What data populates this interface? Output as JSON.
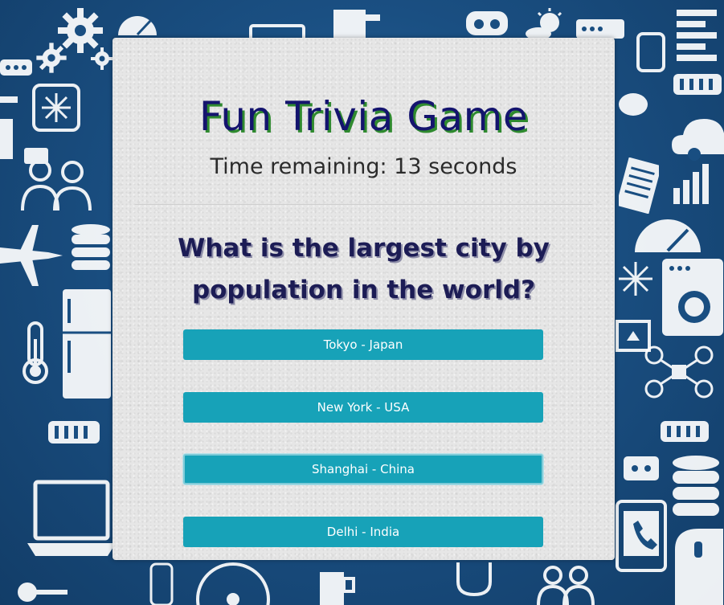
{
  "game": {
    "title": "Fun Trivia Game",
    "timer_text": "Time remaining: 13 seconds",
    "question": "What is the largest city by population in the world?",
    "answers": [
      {
        "label": "Tokyo - Japan"
      },
      {
        "label": "New York - USA"
      },
      {
        "label": "Shanghai - China"
      },
      {
        "label": "Delhi - India"
      }
    ]
  },
  "colors": {
    "background": "#1a4f82",
    "card": "#e6e6e6",
    "title": "#14146e",
    "title_shadow": "#2f8a2f",
    "answer_button": "#17a2b8"
  },
  "background_icons": [
    "gear-icon",
    "speedometer-icon",
    "monitor-icon",
    "vr-headset-icon",
    "weather-icon",
    "server-icon",
    "snowflake-icon",
    "users-icon",
    "airplane-icon",
    "database-icon",
    "fridge-icon",
    "thermometer-icon",
    "laptop-icon",
    "phone-icon",
    "cloud-icon",
    "chart-icon",
    "document-icon",
    "camera-icon",
    "drone-icon",
    "battery-icon"
  ]
}
